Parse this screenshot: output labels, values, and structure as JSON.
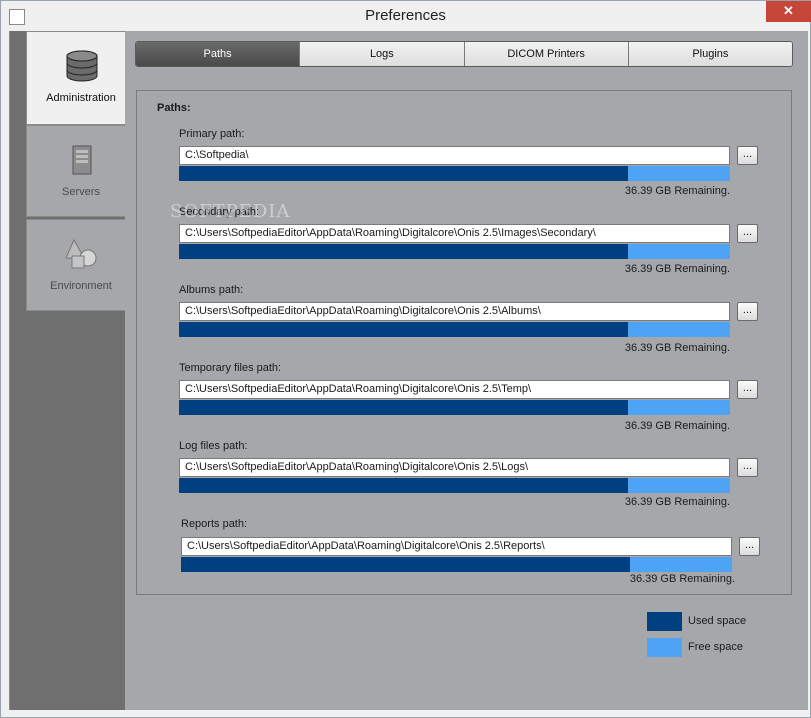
{
  "window": {
    "title": "Preferences",
    "close_label": "✕"
  },
  "sidebar": {
    "items": [
      {
        "label": "Administration",
        "icon": "database-icon",
        "active": true
      },
      {
        "label": "Servers",
        "icon": "server-icon",
        "active": false
      },
      {
        "label": "Environment",
        "icon": "shapes-icon",
        "active": false
      }
    ]
  },
  "tabs": [
    {
      "label": "Paths",
      "active": true
    },
    {
      "label": "Logs",
      "active": false
    },
    {
      "label": "DICOM Printers",
      "active": false
    },
    {
      "label": "Plugins",
      "active": false
    }
  ],
  "paths_group": {
    "title": "Paths:",
    "browse_label": "...",
    "used_fraction": 0.815,
    "entries": [
      {
        "label": "Primary path:",
        "value": "C:\\Softpedia\\",
        "remaining": "36.39 GB Remaining."
      },
      {
        "label": "Secondary path:",
        "value": "C:\\Users\\SoftpediaEditor\\AppData\\Roaming\\Digitalcore\\Onis 2.5\\Images\\Secondary\\",
        "remaining": "36.39 GB Remaining."
      },
      {
        "label": "Albums path:",
        "value": "C:\\Users\\SoftpediaEditor\\AppData\\Roaming\\Digitalcore\\Onis 2.5\\Albums\\",
        "remaining": "36.39 GB Remaining."
      },
      {
        "label": "Temporary files path:",
        "value": "C:\\Users\\SoftpediaEditor\\AppData\\Roaming\\Digitalcore\\Onis 2.5\\Temp\\",
        "remaining": "36.39 GB Remaining."
      },
      {
        "label": "Log files path:",
        "value": "C:\\Users\\SoftpediaEditor\\AppData\\Roaming\\Digitalcore\\Onis 2.5\\Logs\\",
        "remaining": "36.39 GB Remaining."
      },
      {
        "label": "Reports path:",
        "value": "C:\\Users\\SoftpediaEditor\\AppData\\Roaming\\Digitalcore\\Onis 2.5\\Reports\\",
        "remaining": "36.39 GB Remaining."
      }
    ]
  },
  "legend": {
    "used_label": "Used space",
    "free_label": "Free space",
    "used_color": "#004080",
    "free_color": "#4fa3f5"
  },
  "watermark": "SOFTPEDIA"
}
